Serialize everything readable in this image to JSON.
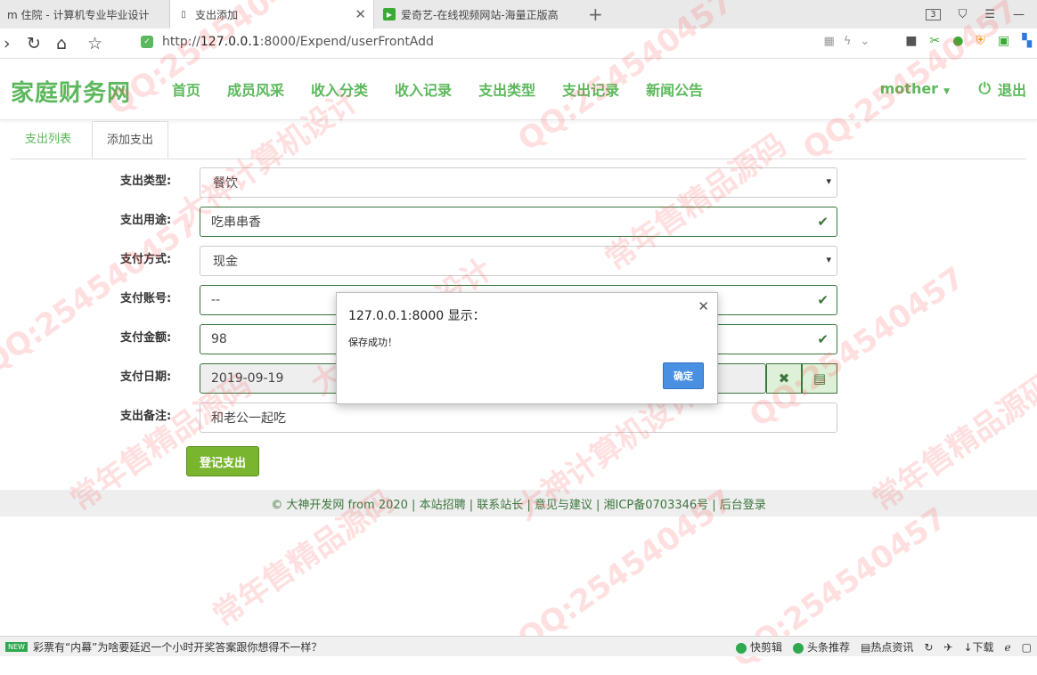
{
  "browser": {
    "tabs": [
      {
        "title": "m 住院 - 计算机专业毕业设计"
      },
      {
        "title": "支出添加"
      },
      {
        "title": "爱奇艺-在线视频网站-海量正版高"
      }
    ],
    "tab_count_badge": "3",
    "url_prefix": "http://",
    "url_host": "127.0.0.1",
    "url_rest": ":8000/Expend/userFrontAdd"
  },
  "site": {
    "brand": "家庭财务网",
    "menu": [
      "首页",
      "成员风采",
      "收入分类",
      "收入记录",
      "支出类型",
      "支出记录",
      "新闻公告"
    ],
    "user": "mother",
    "logout": "退出"
  },
  "page_tabs": [
    "支出列表",
    "添加支出"
  ],
  "form": {
    "type_label": "支出类型:",
    "type_value": "餐饮",
    "use_label": "支出用途:",
    "use_value": "吃串串香",
    "method_label": "支付方式:",
    "method_value": "现金",
    "account_label": "支付账号:",
    "account_value": "--",
    "amount_label": "支付金额:",
    "amount_value": "98",
    "date_label": "支付日期:",
    "date_value": "2019-09-19",
    "note_label": "支出备注:",
    "note_value": "和老公一起吃",
    "submit_label": "登记支出"
  },
  "footer": {
    "text": "© 大神开发网 from 2020 | 本站招聘 | 联系站长 | 意见与建议 | 湘ICP备0703346号 | 后台登录"
  },
  "dialog": {
    "title": "127.0.0.1:8000 显示：",
    "message": "保存成功！",
    "ok_label": "确定"
  },
  "statusbar": {
    "new_badge": "NEW",
    "news": "彩票有“内幕”为啥要延迟一个小时开奖答案跟你想得不一样？",
    "items": [
      "快剪辑",
      "头条推荐",
      "热点资讯",
      "下载"
    ]
  },
  "watermarks": [
    "QQ:254540457",
    "大神计算机设计",
    "常年售精品源码"
  ]
}
